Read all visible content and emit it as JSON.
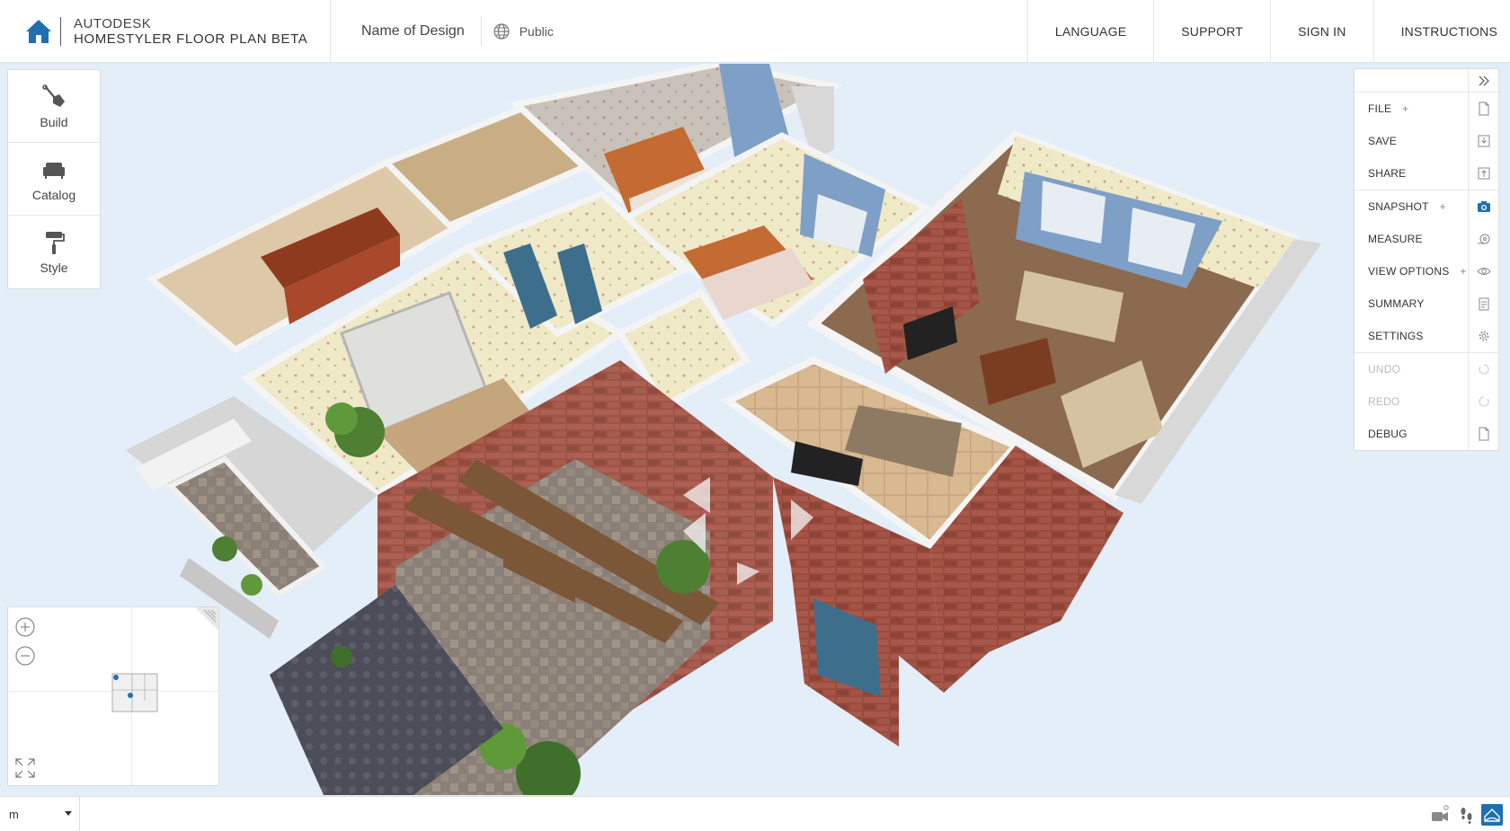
{
  "header": {
    "brand_company": "AUTODESK",
    "brand_product": "HOMESTYLER",
    "brand_suffix": "FLOOR PLAN BETA",
    "design_name": "Name of Design",
    "visibility": "Public",
    "nav": [
      "LANGUAGE",
      "SUPPORT",
      "SIGN IN",
      "INSTRUCTIONS"
    ],
    "brand_color": "#1f6fb2"
  },
  "tools": [
    {
      "label": "Build",
      "icon": "shovel-icon"
    },
    {
      "label": "Catalog",
      "icon": "sofa-icon"
    },
    {
      "label": "Style",
      "icon": "paint-roller-icon"
    }
  ],
  "right_panel": {
    "groups": [
      [
        {
          "label": "FILE",
          "plus": "+",
          "icon": "file-icon"
        },
        {
          "label": "SAVE",
          "icon": "save-icon"
        },
        {
          "label": "SHARE",
          "icon": "share-icon"
        }
      ],
      [
        {
          "label": "SNAPSHOT",
          "plus": "+",
          "icon": "camera-icon"
        },
        {
          "label": "MEASURE",
          "icon": "tape-measure-icon"
        },
        {
          "label": "VIEW OPTIONS",
          "plus": "+",
          "icon": "eye-icon"
        },
        {
          "label": "SUMMARY",
          "icon": "clipboard-icon"
        },
        {
          "label": "SETTINGS",
          "icon": "gear-icon"
        }
      ],
      [
        {
          "label": "UNDO",
          "icon": "undo-icon",
          "disabled": true
        },
        {
          "label": "REDO",
          "icon": "redo-icon",
          "disabled": true
        },
        {
          "label": "DEBUG",
          "icon": "debug-file-icon"
        }
      ]
    ]
  },
  "bottom": {
    "unit": "m"
  }
}
